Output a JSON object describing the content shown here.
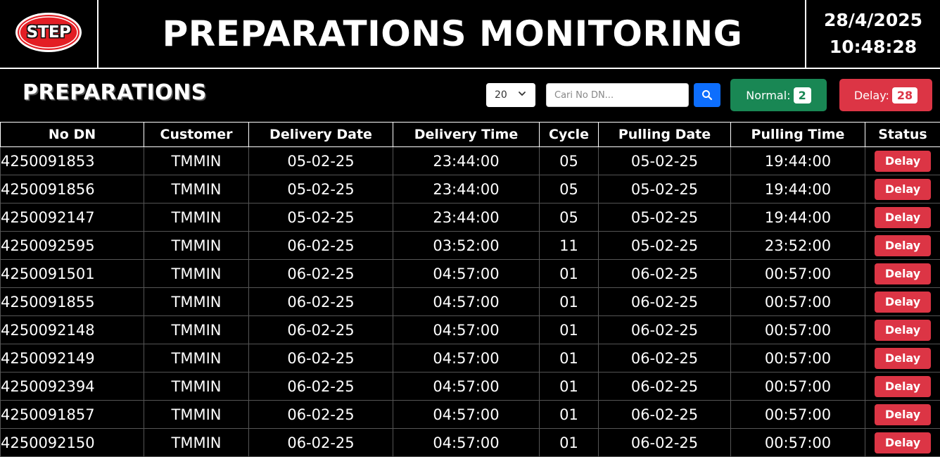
{
  "header": {
    "logo_text": "STEP",
    "title": "PREPARATIONS MONITORING",
    "date": "28/4/2025",
    "time": "10:48:28"
  },
  "toolbar": {
    "section_title": "PREPARATIONS",
    "page_size": "20",
    "search_placeholder": "Cari No DN...",
    "normal_label": "Normal:",
    "normal_count": "2",
    "delay_label": "Delay:",
    "delay_count": "28"
  },
  "colors": {
    "normal": "#198754",
    "delay": "#dc3545",
    "search_button": "#0d6efd",
    "logo_red": "#e31e24"
  },
  "icons": {
    "logo": "step-logo",
    "search": "magnifier-icon",
    "dropdown": "chevron-down-icon"
  },
  "table": {
    "columns": [
      "No DN",
      "Customer",
      "Delivery Date",
      "Delivery Time",
      "Cycle",
      "Pulling Date",
      "Pulling Time",
      "Status"
    ],
    "rows": [
      [
        "4250091853",
        "TMMIN",
        "05-02-25",
        "23:44:00",
        "05",
        "05-02-25",
        "19:44:00",
        "Delay"
      ],
      [
        "4250091856",
        "TMMIN",
        "05-02-25",
        "23:44:00",
        "05",
        "05-02-25",
        "19:44:00",
        "Delay"
      ],
      [
        "4250092147",
        "TMMIN",
        "05-02-25",
        "23:44:00",
        "05",
        "05-02-25",
        "19:44:00",
        "Delay"
      ],
      [
        "4250092595",
        "TMMIN",
        "06-02-25",
        "03:52:00",
        "11",
        "05-02-25",
        "23:52:00",
        "Delay"
      ],
      [
        "4250091501",
        "TMMIN",
        "06-02-25",
        "04:57:00",
        "01",
        "06-02-25",
        "00:57:00",
        "Delay"
      ],
      [
        "4250091855",
        "TMMIN",
        "06-02-25",
        "04:57:00",
        "01",
        "06-02-25",
        "00:57:00",
        "Delay"
      ],
      [
        "4250092148",
        "TMMIN",
        "06-02-25",
        "04:57:00",
        "01",
        "06-02-25",
        "00:57:00",
        "Delay"
      ],
      [
        "4250092149",
        "TMMIN",
        "06-02-25",
        "04:57:00",
        "01",
        "06-02-25",
        "00:57:00",
        "Delay"
      ],
      [
        "4250092394",
        "TMMIN",
        "06-02-25",
        "04:57:00",
        "01",
        "06-02-25",
        "00:57:00",
        "Delay"
      ],
      [
        "4250091857",
        "TMMIN",
        "06-02-25",
        "04:57:00",
        "01",
        "06-02-25",
        "00:57:00",
        "Delay"
      ],
      [
        "4250092150",
        "TMMIN",
        "06-02-25",
        "04:57:00",
        "01",
        "06-02-25",
        "00:57:00",
        "Delay"
      ]
    ]
  }
}
